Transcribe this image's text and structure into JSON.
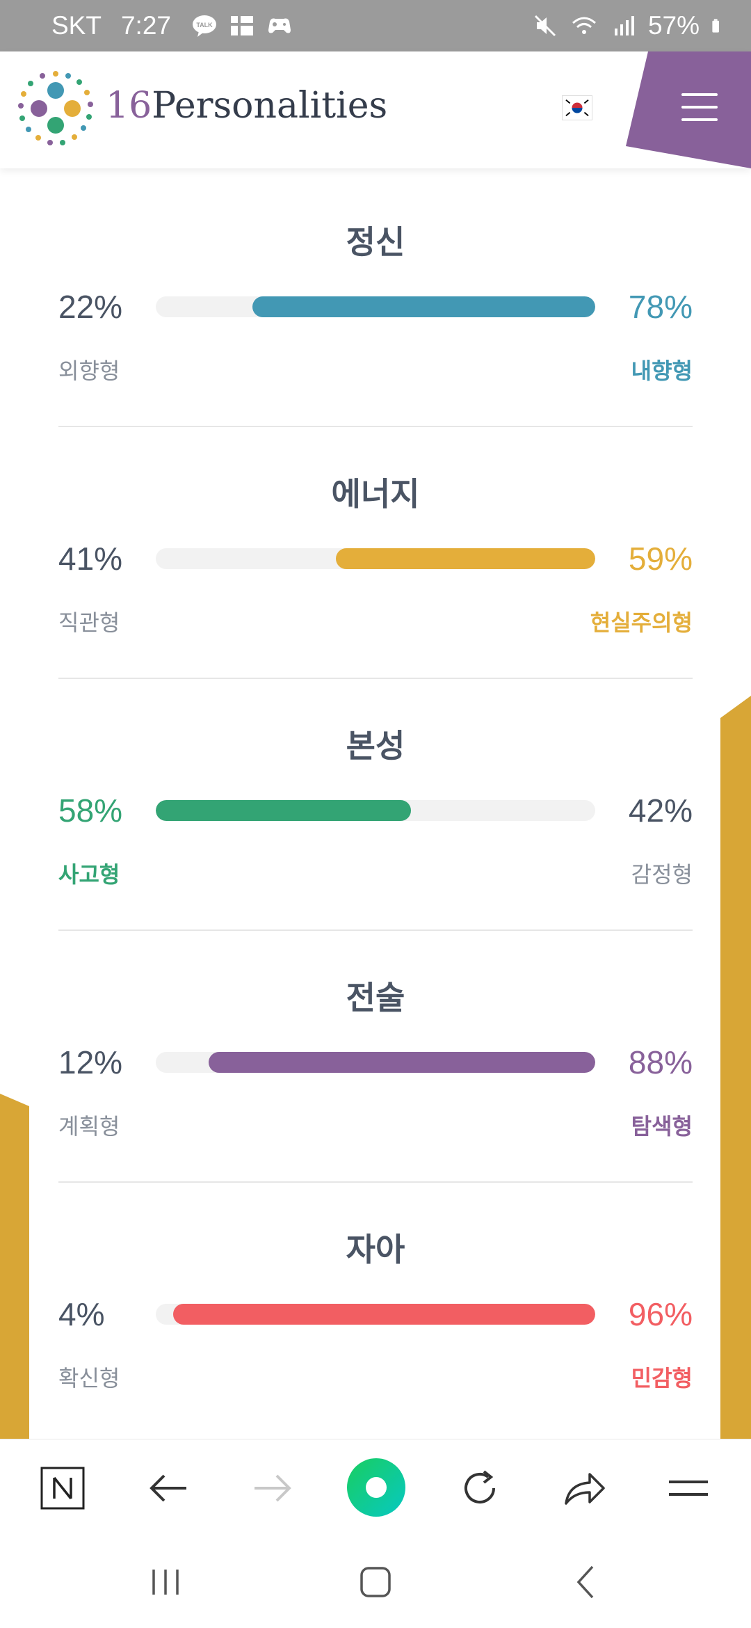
{
  "status_bar": {
    "carrier": "SKT",
    "time": "7:27",
    "battery": "57%"
  },
  "header": {
    "logo_number": "16",
    "logo_word": "Personalities",
    "flag_icon": "korea-flag-icon",
    "menu_icon": "hamburger-menu-icon",
    "menu_color": "#88619a"
  },
  "traits": [
    {
      "title": "정신",
      "left_pct": "22%",
      "right_pct": "78%",
      "left_label": "외향형",
      "right_label": "내향형",
      "dominant": "right",
      "color": "#4298b4",
      "fill_fraction": 0.78
    },
    {
      "title": "에너지",
      "left_pct": "41%",
      "right_pct": "59%",
      "left_label": "직관형",
      "right_label": "현실주의형",
      "dominant": "right",
      "color": "#e4ae3a",
      "fill_fraction": 0.59
    },
    {
      "title": "본성",
      "left_pct": "58%",
      "right_pct": "42%",
      "left_label": "사고형",
      "right_label": "감정형",
      "dominant": "left",
      "color": "#33a474",
      "fill_fraction": 0.58
    },
    {
      "title": "전술",
      "left_pct": "12%",
      "right_pct": "88%",
      "left_label": "계획형",
      "right_label": "탐색형",
      "dominant": "right",
      "color": "#88619a",
      "fill_fraction": 0.88
    },
    {
      "title": "자아",
      "left_pct": "4%",
      "right_pct": "96%",
      "left_label": "확신형",
      "right_label": "민감형",
      "dominant": "right",
      "color": "#f25e62",
      "fill_fraction": 0.96
    }
  ],
  "colors": {
    "neutral_text": "#4a5464",
    "muted_label": "#888f9a",
    "deco_gold": "#d8a636"
  },
  "browser_bar": {
    "icons": [
      "naver-n-icon",
      "back-arrow-icon",
      "forward-arrow-icon",
      "home-green-circle-icon",
      "refresh-icon",
      "share-icon",
      "menu-lines-icon"
    ]
  },
  "nav_bar": {
    "icons": [
      "recent-apps-icon",
      "home-icon",
      "back-icon"
    ]
  }
}
